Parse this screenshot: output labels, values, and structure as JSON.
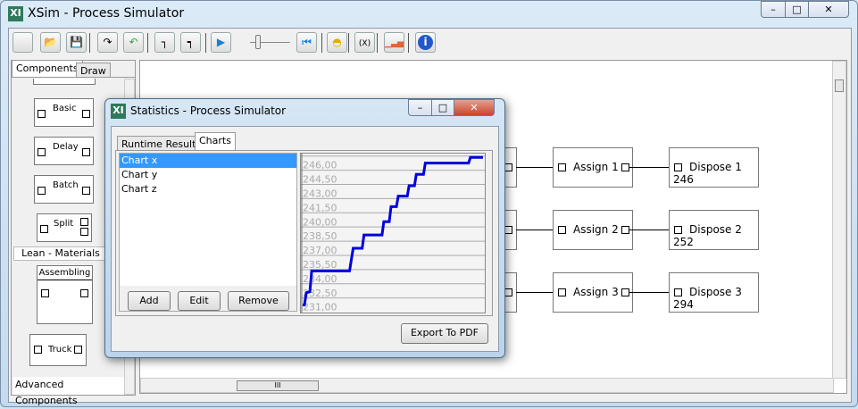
{
  "window": {
    "title": "XSim - Process Simulator",
    "logo": "XI",
    "min": "–",
    "max": "□",
    "close": "✕"
  },
  "toolbar": [
    {
      "name": "new",
      "icon": "new-icon",
      "glyph": ""
    },
    {
      "name": "open",
      "icon": "folder-icon",
      "glyph": "📂"
    },
    {
      "name": "save",
      "icon": "save-icon",
      "glyph": "💾"
    },
    {
      "name": "redo",
      "icon": "redo-icon",
      "glyph": "↷"
    },
    {
      "name": "undo",
      "icon": "undo-icon",
      "glyph": "↶"
    },
    {
      "name": "connect",
      "icon": "connect-icon",
      "glyph": "┐"
    },
    {
      "name": "connect-alt",
      "icon": "connect-node-icon",
      "glyph": "┑"
    },
    {
      "name": "play",
      "icon": "play-icon",
      "glyph": "▶"
    },
    {
      "name": "reset",
      "icon": "skip-back-icon",
      "glyph": "⏮"
    },
    {
      "name": "resources",
      "icon": "hardhat-icon",
      "glyph": "◓"
    },
    {
      "name": "variables",
      "icon": "variable-icon",
      "glyph": "(X)"
    },
    {
      "name": "statistics",
      "icon": "bar-chart-icon",
      "glyph": "▁▃▅"
    },
    {
      "name": "about",
      "icon": "info-icon",
      "glyph": "i"
    }
  ],
  "left_panel": {
    "tabs": [
      "Components",
      "Draw"
    ],
    "components": [
      "Basic",
      "Delay",
      "Batch",
      "Split"
    ],
    "section": "Lean - Materials",
    "lean": [
      "Assembling",
      "Truck"
    ],
    "footer": "Advanced Components"
  },
  "diagram": {
    "rows": [
      {
        "assign": "Assign 1",
        "dispose": "Dispose 1",
        "count": "246"
      },
      {
        "assign": "Assign 2",
        "dispose": "Dispose 2",
        "count": "252"
      },
      {
        "assign": "Assign 3",
        "dispose": "Dispose 3",
        "count": "294"
      }
    ]
  },
  "scrollbar_grip": "III",
  "dialog": {
    "title": "Statistics - Process Simulator",
    "logo": "XI",
    "tabs": [
      "Runtime Results",
      "Charts"
    ],
    "charts": [
      "Chart x",
      "Chart y",
      "Chart z"
    ],
    "buttons": {
      "add": "Add",
      "edit": "Edit",
      "remove": "Remove",
      "export": "Export To PDF"
    }
  },
  "chart_data": {
    "type": "line",
    "title": "Chart x",
    "xlabel": "",
    "ylabel": "",
    "yticks": [
      "246,00",
      "244,50",
      "243,00",
      "241,50",
      "240,00",
      "238,50",
      "237,00",
      "235,50",
      "234,00",
      "232,50",
      "231,00"
    ],
    "ylim": [
      230.4,
      247.2
    ],
    "xlim": [
      0,
      100
    ],
    "grid": true,
    "color": "#0000dd",
    "x": [
      0,
      1,
      2,
      4,
      5,
      26,
      28,
      33,
      34,
      44,
      45,
      48,
      49,
      52,
      53,
      58,
      59,
      62,
      63,
      67,
      68,
      92,
      93,
      100
    ],
    "y": [
      231.2,
      231.2,
      232.5,
      232.6,
      234.8,
      234.8,
      237.2,
      237.2,
      238.6,
      238.6,
      240.0,
      240.0,
      241.6,
      241.6,
      242.7,
      242.7,
      243.8,
      243.8,
      245.0,
      245.0,
      246.2,
      246.2,
      246.8,
      246.8
    ]
  }
}
